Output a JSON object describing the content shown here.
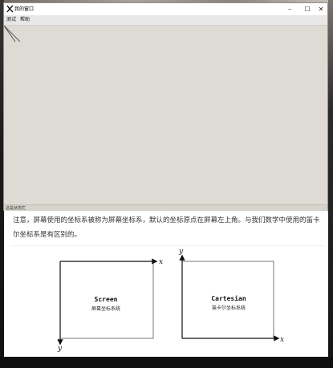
{
  "window": {
    "title": "我的窗口",
    "icon": "python-feather-icon",
    "controls": {
      "minimize": "–",
      "maximize": "☐",
      "close": "✕"
    }
  },
  "menubar": {
    "items": [
      "测试",
      "帮助"
    ]
  },
  "statusbar": {
    "text": "这是状态栏"
  },
  "article": {
    "paragraph": "注意，屏幕使用的坐标系被称为屏幕坐标系，默认的坐标原点在屏幕左上角。与我们数学中使用的笛卡尔坐标系是有区别的。",
    "diagram_screen": {
      "title": "Screen",
      "subtitle": "屏幕坐标系统",
      "x_axis": "x",
      "y_axis": "y"
    },
    "diagram_cartesian": {
      "title": "Cartesian",
      "subtitle": "笛卡尔坐标系统",
      "x_axis": "x",
      "y_axis": "y"
    }
  }
}
